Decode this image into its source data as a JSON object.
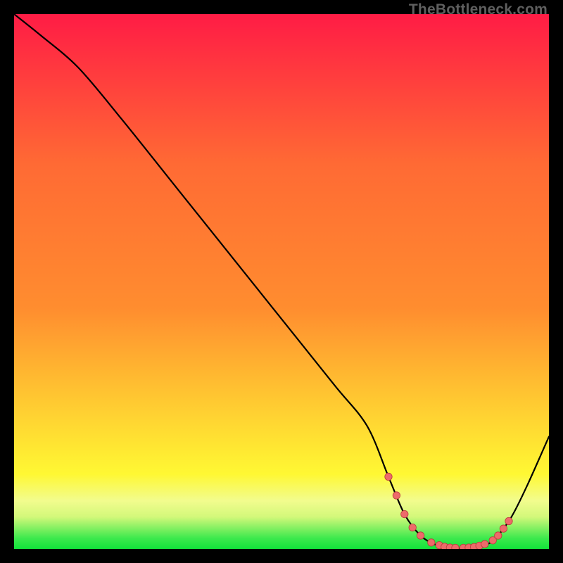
{
  "watermark": "TheBottleneck.com",
  "colors": {
    "green_base": "#12e23a",
    "yellow_mid": "#fff833",
    "orange_mid": "#ff8d2f",
    "red_top": "#ff1c45",
    "curve_stroke": "#000000",
    "dot_fill": "#ed6a6a",
    "dot_stroke": "#b93c3c"
  },
  "chart_data": {
    "type": "line",
    "title": "",
    "xlabel": "",
    "ylabel": "",
    "xlim": [
      0,
      100
    ],
    "ylim": [
      0,
      100
    ],
    "x": [
      0,
      5,
      12,
      20,
      30,
      40,
      50,
      60,
      66,
      70,
      73,
      76,
      79,
      82,
      85,
      88,
      90,
      93,
      96,
      100
    ],
    "values": [
      100,
      96,
      90,
      80.5,
      68,
      55.5,
      43,
      30.5,
      23,
      13.5,
      6.5,
      2.5,
      0.7,
      0.2,
      0.2,
      0.7,
      2,
      6,
      12,
      21
    ],
    "series": [
      {
        "name": "bottleneck-curve",
        "x_ref": "x",
        "y_ref": "values"
      }
    ],
    "highlight_dots": [
      {
        "x": 70,
        "y": 13.5
      },
      {
        "x": 71.5,
        "y": 10
      },
      {
        "x": 73,
        "y": 6.5
      },
      {
        "x": 74.5,
        "y": 4
      },
      {
        "x": 76,
        "y": 2.5
      },
      {
        "x": 78,
        "y": 1.2
      },
      {
        "x": 79.5,
        "y": 0.7
      },
      {
        "x": 80.5,
        "y": 0.4
      },
      {
        "x": 81.5,
        "y": 0.25
      },
      {
        "x": 82.5,
        "y": 0.2
      },
      {
        "x": 84,
        "y": 0.2
      },
      {
        "x": 85,
        "y": 0.25
      },
      {
        "x": 86,
        "y": 0.35
      },
      {
        "x": 87,
        "y": 0.6
      },
      {
        "x": 88,
        "y": 0.9
      },
      {
        "x": 89.5,
        "y": 1.6
      },
      {
        "x": 90.5,
        "y": 2.5
      },
      {
        "x": 91.5,
        "y": 3.8
      },
      {
        "x": 92.5,
        "y": 5.2
      }
    ]
  }
}
